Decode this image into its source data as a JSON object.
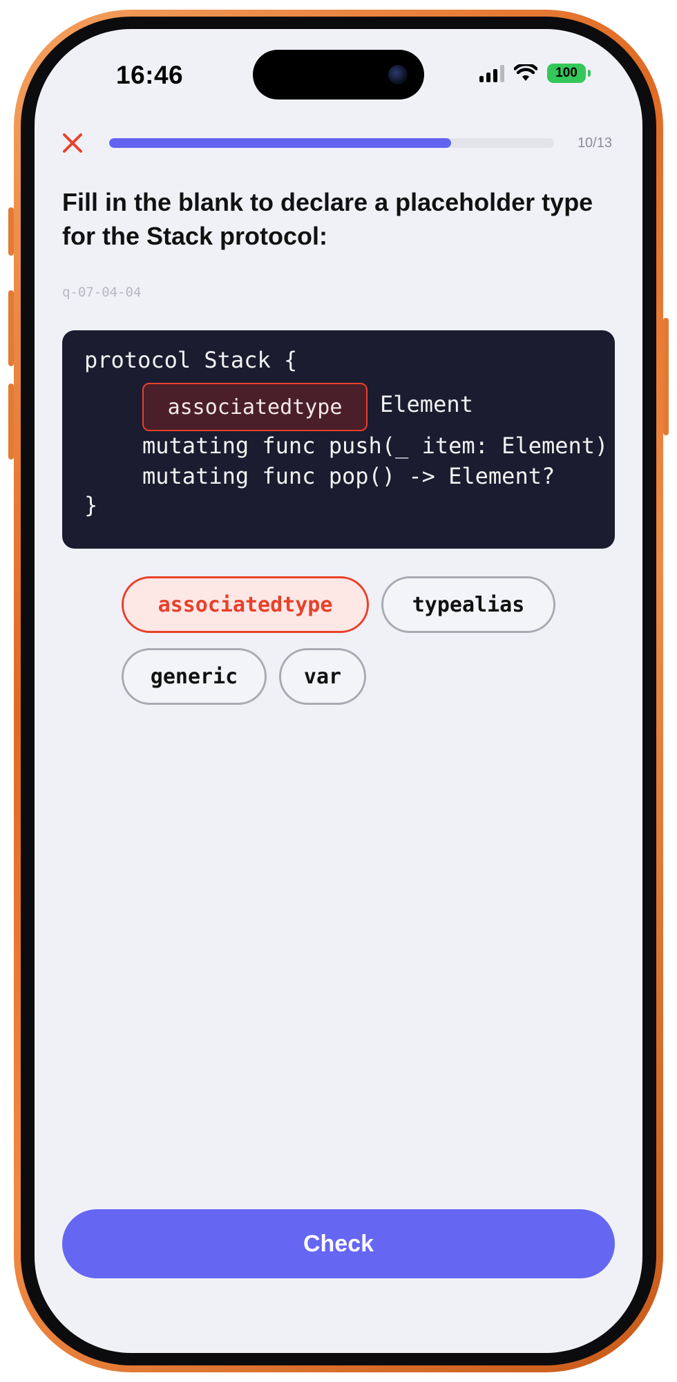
{
  "status_bar": {
    "time": "16:46",
    "battery_level": "100",
    "icons": [
      "cellular-signal-icon",
      "wifi-icon",
      "battery-icon"
    ]
  },
  "header": {
    "close_icon": "close-icon",
    "progress_label": "10/13",
    "progress_current": 10,
    "progress_total": 13
  },
  "question": {
    "prompt": "Fill in the blank to declare a placeholder type for the Stack protocol:",
    "id": "q-07-04-04"
  },
  "code": {
    "line1": "protocol Stack {",
    "blank_answer": "associatedtype",
    "line2_after_blank": "Element",
    "line3": "mutating func push(_ item: Element)",
    "line4": "mutating func pop() -> Element?",
    "line5": "}"
  },
  "options": [
    {
      "label": "associatedtype",
      "selected": true
    },
    {
      "label": "typealias",
      "selected": false
    },
    {
      "label": "generic",
      "selected": false
    },
    {
      "label": "var",
      "selected": false
    }
  ],
  "check_button": {
    "label": "Check"
  },
  "colors": {
    "accent": "#6566f2",
    "error": "#e8412b",
    "code_background": "#1c1c30",
    "frame": "#e06a24"
  }
}
